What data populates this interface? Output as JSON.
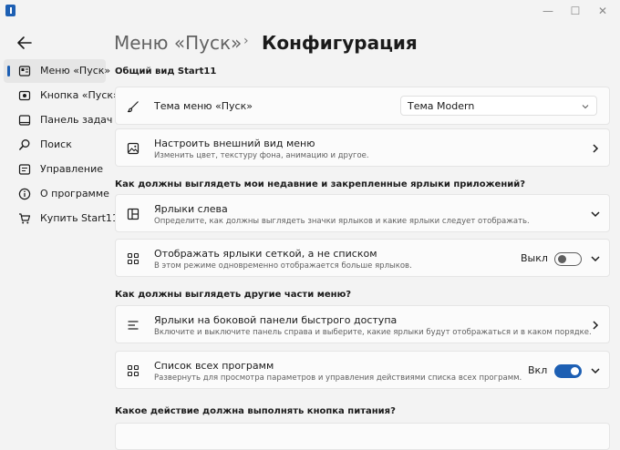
{
  "window": {
    "minimize_glyph": "—",
    "maximize_glyph": "☐",
    "close_glyph": "✕"
  },
  "breadcrumb": {
    "parent": "Меню «Пуск»",
    "separator": "›",
    "current": "Конфигурация"
  },
  "sidebar": {
    "items": [
      {
        "label": "Меню «Пуск»",
        "icon": "start-menu-icon",
        "active": true
      },
      {
        "label": "Кнопка «Пуск»",
        "icon": "start-button-icon"
      },
      {
        "label": "Панель задач",
        "icon": "taskbar-icon"
      },
      {
        "label": "Поиск",
        "icon": "search-icon"
      },
      {
        "label": "Управление",
        "icon": "control-icon"
      },
      {
        "label": "О программе",
        "icon": "info-icon"
      },
      {
        "label": "Купить Start11",
        "icon": "cart-icon"
      }
    ]
  },
  "sections": {
    "general": "Общий вид Start11",
    "shortcuts": "Как должны выглядеть мои недавние и закрепленные ярлыки приложений?",
    "other_parts": "Как должны выглядеть другие части меню?",
    "power_button": "Какое действие должна выполнять кнопка питания?"
  },
  "cards": {
    "theme": {
      "title": "Тема меню «Пуск»",
      "dropdown_value": "Тема Modern",
      "icon": "brush-icon"
    },
    "appearance": {
      "title": "Настроить внешний вид меню",
      "desc": "Изменить цвет, текстуру фона, анимацию и другое.",
      "icon": "image-icon"
    },
    "left_shortcuts": {
      "title": "Ярлыки слева",
      "desc": "Определите, как должны выглядеть значки ярлыков и какие ярлыки следует отображать.",
      "icon": "layout-icon"
    },
    "grid_shortcuts": {
      "title": "Отображать ярлыки сеткой, а не списком",
      "desc": "В этом режиме одновременно отображается больше ярлыков.",
      "toggle_label": "Выкл",
      "toggle_on": false,
      "icon": "grid-icon"
    },
    "side_panel": {
      "title": "Ярлыки на боковой панели быстрого доступа",
      "desc": "Включите и выключите панель справа и выберите, какие ярлыки будут отображаться и в каком порядке.",
      "icon": "list-icon"
    },
    "all_programs": {
      "title": "Список всех программ",
      "desc": "Развернуть для просмотра параметров и управления действиями списка всех программ.",
      "toggle_label": "Вкл",
      "toggle_on": true,
      "icon": "grid-icon"
    }
  },
  "colors": {
    "accent": "#1d5fb3",
    "background": "#f3f3f3",
    "card": "#fbfbfb"
  }
}
